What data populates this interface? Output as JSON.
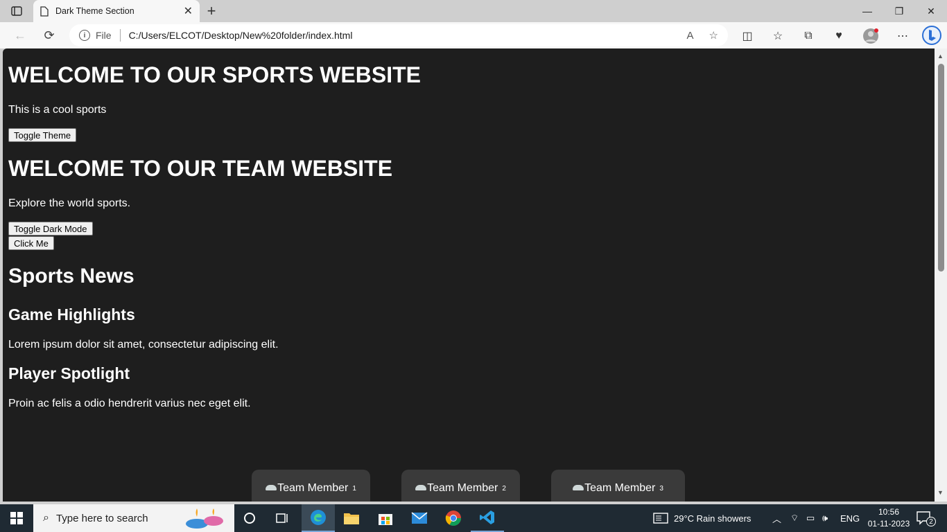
{
  "browser": {
    "tab_title": "Dark Theme Section",
    "address_file_label": "File",
    "address_url": "C:/Users/ELCOT/Desktop/New%20folder/index.html"
  },
  "page": {
    "heading1": "WELCOME TO OUR SPORTS WEBSITE",
    "para1": "This is a cool sports",
    "toggle_theme_label": "Toggle Theme",
    "heading2": "WELCOME TO OUR TEAM WEBSITE",
    "para2": "Explore the world sports.",
    "toggle_dark_label": "Toggle Dark Mode",
    "click_me_label": "Click Me",
    "news_heading": "Sports News",
    "articles": [
      {
        "title": "Game Highlights",
        "body": "Lorem ipsum dolor sit amet, consectetur adipiscing elit."
      },
      {
        "title": "Player Spotlight",
        "body": "Proin ac felis a odio hendrerit varius nec eget elit."
      }
    ],
    "members": [
      {
        "label": "Team Member",
        "suffix": "1"
      },
      {
        "label": "Team Member",
        "suffix": "2"
      },
      {
        "label": "Team Member",
        "suffix": "3"
      }
    ],
    "colors": {
      "background": "#1e1e1e",
      "text": "#ffffff",
      "card": "#3a3a3a"
    }
  },
  "taskbar": {
    "search_placeholder": "Type here to search",
    "weather": "29°C  Rain showers",
    "language": "ENG",
    "time": "10:56",
    "date": "01-11-2023",
    "notification_count": "2"
  }
}
